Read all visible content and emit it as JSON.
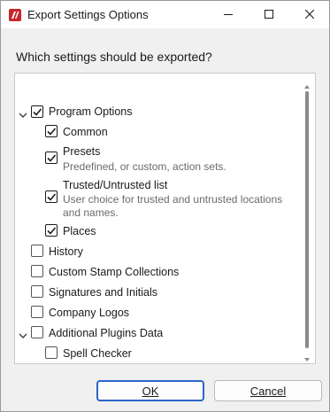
{
  "window": {
    "title": "Export Settings Options",
    "controls": {
      "minimize": "minimize",
      "maximize": "maximize",
      "close": "close"
    }
  },
  "prompt": "Which settings should be exported?",
  "tree": {
    "items": [
      {
        "label": "Program Options",
        "checked": true,
        "expanded": true
      },
      {
        "label": "Common",
        "checked": true
      },
      {
        "label": "Presets",
        "checked": true,
        "description": "Predefined, or custom, action sets."
      },
      {
        "label": "Trusted/Untrusted list",
        "checked": true,
        "description_line1": "User choice for trusted and untrusted locations",
        "description_line2": "and names."
      },
      {
        "label": "Places",
        "checked": true
      },
      {
        "label": "History",
        "checked": false
      },
      {
        "label": "Custom Stamp Collections",
        "checked": false
      },
      {
        "label": "Signatures and Initials",
        "checked": false
      },
      {
        "label": "Company Logos",
        "checked": false
      },
      {
        "label": "Additional Plugins Data",
        "checked": false,
        "expanded": true
      },
      {
        "label": "Spell Checker",
        "checked": false
      }
    ]
  },
  "buttons": {
    "ok_label": "OK",
    "cancel_label": "Cancel"
  },
  "colors": {
    "accent": "#2b66c9",
    "checkmark": "#1a1a1a",
    "description_text": "#6b6b6b"
  }
}
